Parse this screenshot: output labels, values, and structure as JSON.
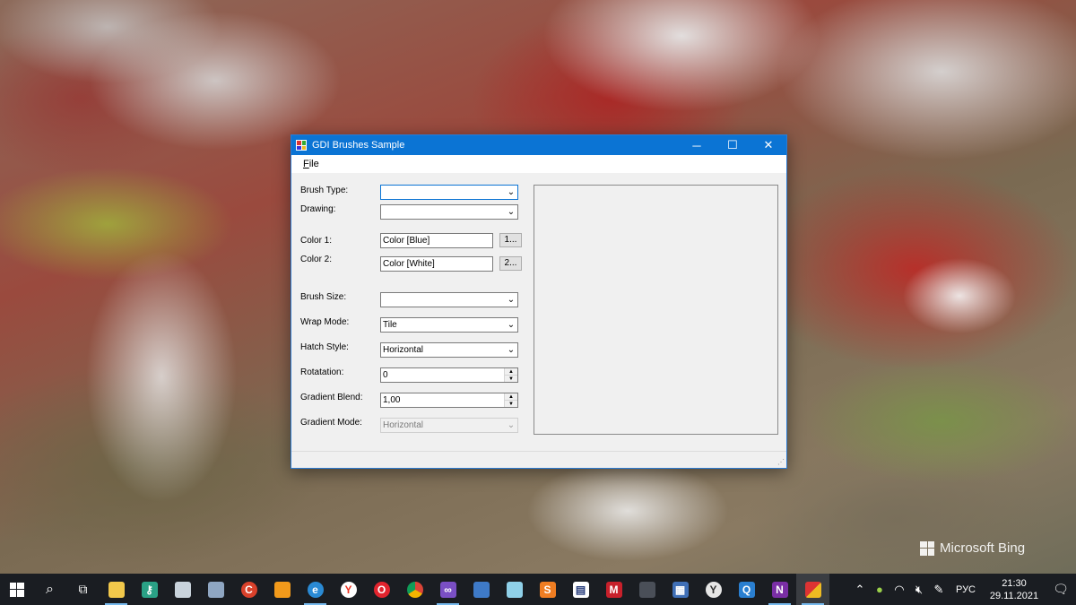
{
  "window": {
    "title": "GDI Brushes Sample",
    "minimize": "─",
    "maximize": "☐",
    "close": "✕"
  },
  "menu": {
    "file_underlined": "F",
    "file_rest": "ile"
  },
  "form": {
    "brush_type_label": "Brush Type:",
    "brush_type_value": "",
    "drawing_label": "Drawing:",
    "drawing_value": "",
    "color1_label": "Color 1:",
    "color1_value": "Color [Blue]",
    "color1_button": "1...",
    "color2_label": "Color 2:",
    "color2_value": "Color [White]",
    "color2_button": "2...",
    "brush_size_label": "Brush Size:",
    "brush_size_value": "",
    "wrap_mode_label": "Wrap Mode:",
    "wrap_mode_value": "Tile",
    "hatch_style_label": "Hatch Style:",
    "hatch_style_value": "Horizontal",
    "rotation_label": "Rotatation:",
    "rotation_value": "0",
    "gradient_blend_label": "Gradient Blend:",
    "gradient_blend_value": "1,00",
    "gradient_mode_label": "Gradient Mode:",
    "gradient_mode_value": "Horizontal"
  },
  "watermark": "Microsoft Bing",
  "taskbar": {
    "apps": [
      "windows-start",
      "search",
      "task-view",
      "file-explorer",
      "keepass",
      "app-6",
      "app-7",
      "ccleaner",
      "app-9",
      "edge",
      "yandex-browser",
      "opera",
      "chrome",
      "visual-studio",
      "app-15",
      "app-16",
      "sublime-text",
      "app-18",
      "app-19",
      "app-20",
      "calculator",
      "app-22",
      "app-23",
      "onenote",
      "gdi-brushes"
    ],
    "lang": "РУС",
    "time": "21:30",
    "date": "29.11.2021"
  }
}
